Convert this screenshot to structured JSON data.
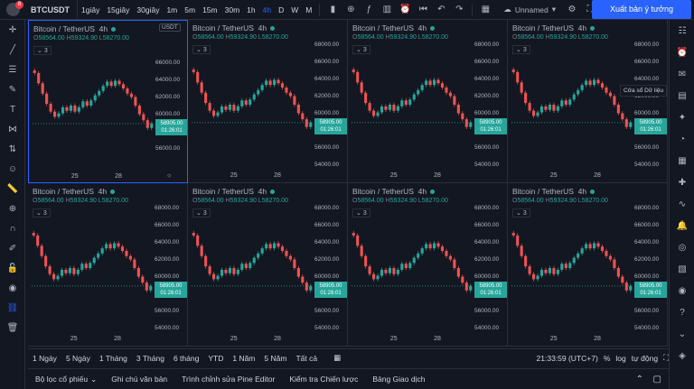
{
  "topbar": {
    "notification_count": "8",
    "symbol": "BTCUSDT",
    "intervals": [
      "1giây",
      "15giây",
      "30giây",
      "1m",
      "5m",
      "15m",
      "30m",
      "1h",
      "4h",
      "D",
      "W",
      "M"
    ],
    "active_interval": "4h",
    "layout_name": "Unnamed",
    "publish_label": "Xuất bản ý tưởng"
  },
  "pane_common": {
    "title": "Bitcoin / TetherUS",
    "interval": "4h",
    "ohlc_o": "58564.00",
    "ohlc_h": "59324.90",
    "ohlc_l": "58270.00",
    "collapsed_count": "3",
    "price_tag_value": "58905.00",
    "price_tag_countdown": "01:26:01",
    "currency": "USDT",
    "y_ticks": [
      "68000.00",
      "66000.00",
      "64000.00",
      "62000.00",
      "60000.00",
      "58000.00",
      "56000.00",
      "54000.00"
    ],
    "x_ticks": [
      "25",
      "28"
    ]
  },
  "chart_data": {
    "type": "candlestick",
    "symbol": "Bitcoin / TetherUS",
    "interval": "4h",
    "ylim": [
      53000,
      69000
    ],
    "current_price": 58905.0,
    "x_labels": [
      "25",
      "28"
    ],
    "closes": [
      64800,
      63600,
      62400,
      61200,
      60300,
      59700,
      60100,
      60800,
      60400,
      61000,
      60300,
      60800,
      61500,
      61000,
      61600,
      62200,
      62700,
      63300,
      63800,
      63300,
      63900,
      63500,
      63000,
      62400,
      62000,
      61000,
      60000,
      59300,
      58400,
      58905
    ]
  },
  "tooltip_text": "Cửa sổ Dữ liệu",
  "rangebar": {
    "ranges": [
      "1 Ngày",
      "5 Ngày",
      "1 Tháng",
      "3 Tháng",
      "6 tháng",
      "YTD",
      "1 Năm",
      "5 Năm",
      "Tất cả"
    ],
    "time": "21:33:59 (UTC+7)",
    "pct": "%",
    "log": "log",
    "auto": "tự động"
  },
  "bottombar": {
    "tabs": [
      "Bộ lọc cổ phiếu",
      "Ghi chú văn bản",
      "Trình chỉnh sửa Pine Editor",
      "Kiểm tra Chiến lược",
      "Bảng Giao dịch"
    ]
  },
  "colors": {
    "up": "#26a69a",
    "down": "#ef5350",
    "accent": "#2962ff",
    "background": "#131722"
  }
}
